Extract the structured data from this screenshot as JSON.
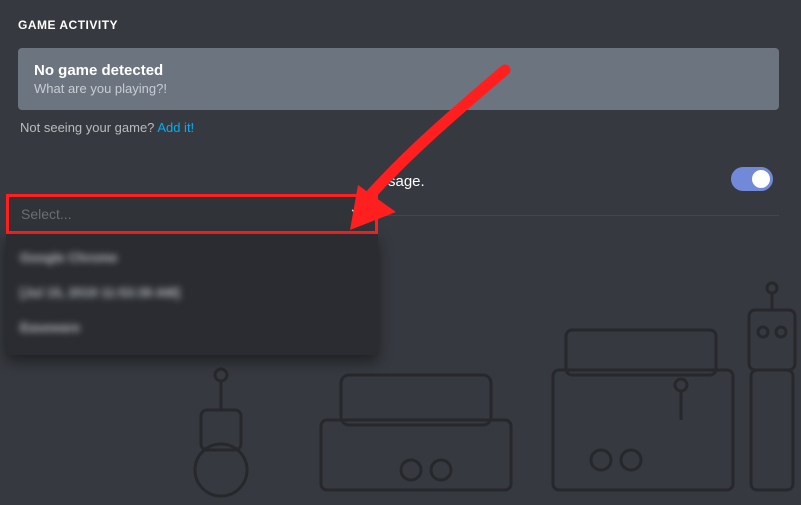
{
  "section_title": "GAME ACTIVITY",
  "no_game": {
    "title": "No game detected",
    "subtitle": "What are you playing?!"
  },
  "add_game": {
    "prompt": "Not seeing your game? ",
    "link": "Add it!"
  },
  "status_message_suffix": "sage.",
  "toggle_on": true,
  "dropdown": {
    "placeholder": "Select...",
    "options": [
      {
        "label": "Google Chrome",
        "blurred": true
      },
      {
        "label": "[Jul 15, 2019 11:53:39 AM]",
        "blurred": true
      },
      {
        "label": "Easeware",
        "blurred": true
      }
    ]
  }
}
